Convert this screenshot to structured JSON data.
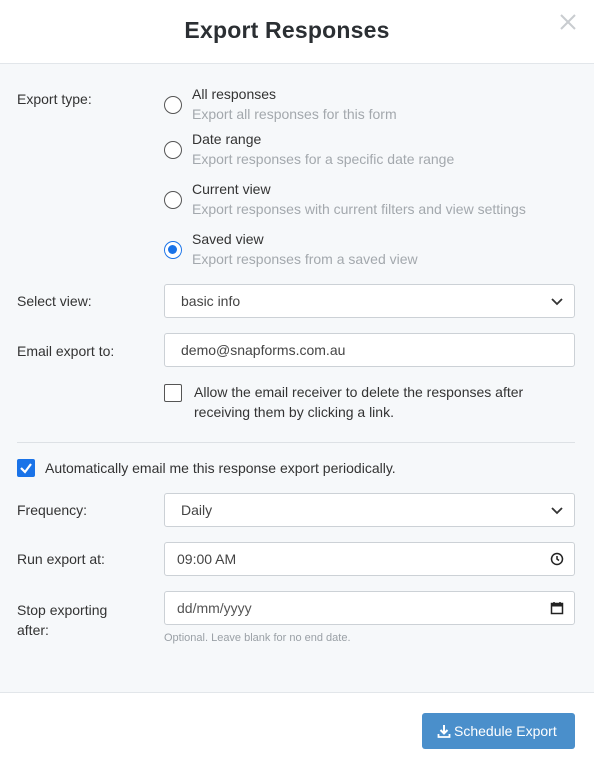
{
  "dialog": {
    "title": "Export Responses",
    "close_icon": "close-icon"
  },
  "export_type": {
    "label": "Export type:",
    "options": [
      {
        "title": "All responses",
        "description": "Export all responses for this form",
        "selected": false
      },
      {
        "title": "Date range",
        "description": "Export responses for a specific date range",
        "selected": false
      },
      {
        "title": "Current view",
        "description": "Export responses with current filters and view settings",
        "selected": false
      },
      {
        "title": "Saved view",
        "description": "Export responses from a saved view",
        "selected": true
      }
    ]
  },
  "select_view": {
    "label": "Select view:",
    "value": "basic info"
  },
  "email_export": {
    "label": "Email export to:",
    "value": "demo@snapforms.com.au",
    "allow_delete_checked": false,
    "allow_delete_line1": "Allow the email receiver to delete the responses after",
    "allow_delete_line2": "receiving them by clicking a link."
  },
  "auto_email": {
    "checked": true,
    "label": "Automatically email me this response export periodically."
  },
  "frequency": {
    "label": "Frequency:",
    "value": "Daily"
  },
  "run_export": {
    "label": "Run export at:",
    "value": "09:00 AM"
  },
  "stop_exporting": {
    "label_line1": "Stop exporting",
    "label_line2": "after:",
    "placeholder": "dd/mm/yyyy",
    "hint": "Optional. Leave blank for no end date."
  },
  "footer": {
    "schedule_button": "Schedule Export"
  },
  "colors": {
    "accent": "#1a73e8",
    "button": "#4a8fcb",
    "muted_text": "#a3a8ad"
  }
}
